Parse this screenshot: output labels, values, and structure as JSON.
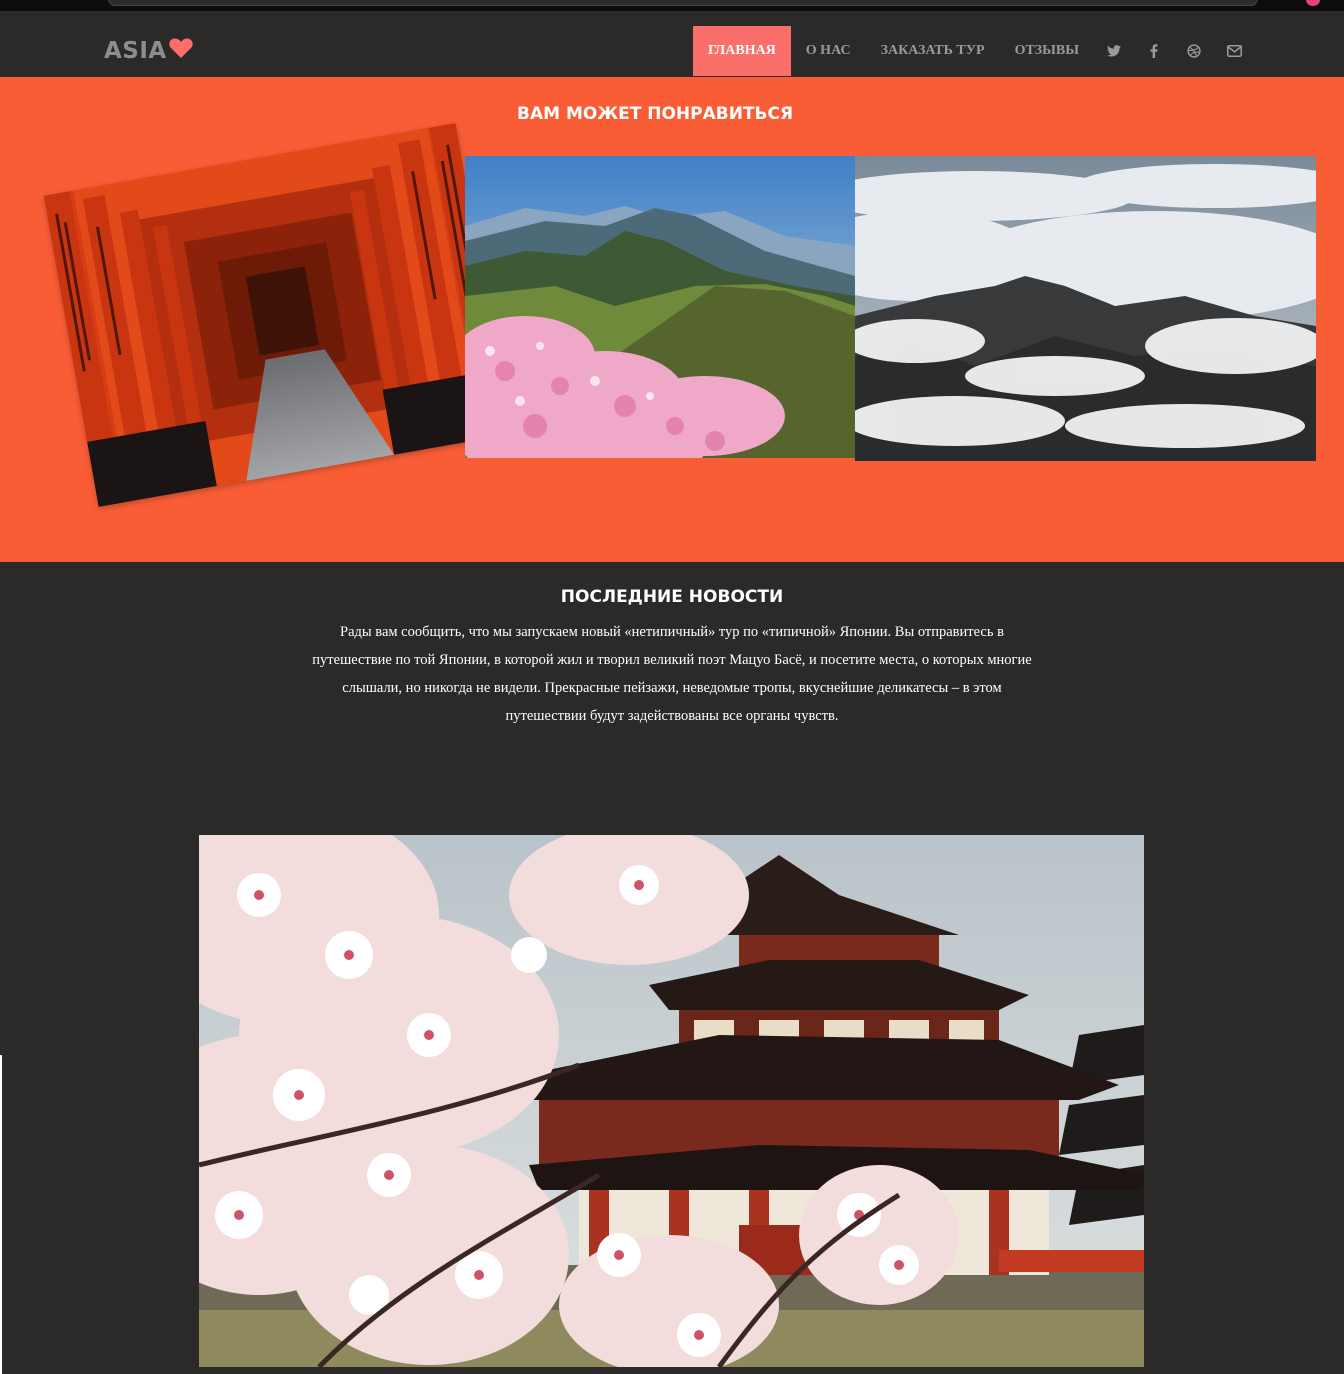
{
  "brand": {
    "name": "ASIA",
    "heart_icon": "heart-icon",
    "heart_color": "#fb6f6b"
  },
  "nav": {
    "items": [
      {
        "label": "Главная",
        "active": true
      },
      {
        "label": "О нас",
        "active": false
      },
      {
        "label": "Заказать тур",
        "active": false
      },
      {
        "label": "Отзывы",
        "active": false
      }
    ],
    "social_icons": [
      "twitter-icon",
      "facebook-icon",
      "dribbble-icon",
      "envelope-icon"
    ]
  },
  "recommend": {
    "title": "Вам может понравиться",
    "images": [
      "torii-gates-photo",
      "mountain-azaleas-photo",
      "clouds-mountains-photo"
    ]
  },
  "news": {
    "title": "Последние новости",
    "text": "Рады вам сообщить, что мы запускаем новый «нетипичный» тур по «типичной» Японии. Вы отправитесь в путешествие по той Японии, в которой жил и творил великий поэт Мацуо Басё, и посетите места, о которых многие слышали, но никогда не видели. Прекрасные пейзажи, неведомые тропы, вкуснейшие деликатесы – в этом путешествии будут задействованы все органы чувств.",
    "image": "sakura-temple-photo"
  },
  "colors": {
    "accent": "#f85d36",
    "nav_active": "#fb6f6b",
    "background": "#2b2a29"
  }
}
